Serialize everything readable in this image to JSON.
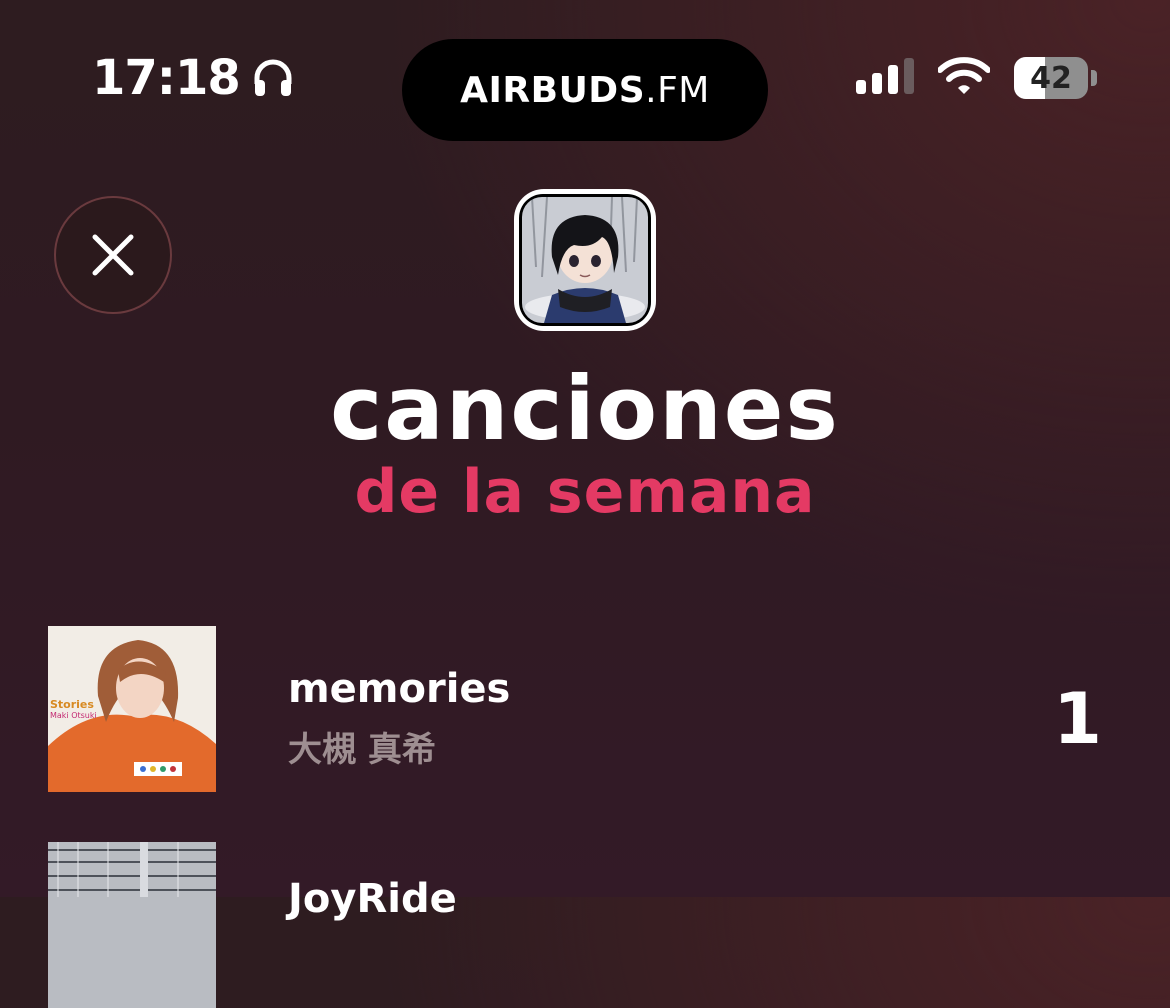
{
  "status_bar": {
    "time": "17:18",
    "battery": "42"
  },
  "brand": {
    "bold": "AIRBUDS",
    "thin": ".FM"
  },
  "header": {
    "title": "canciones",
    "subtitle": "de la semana",
    "accent_color": "#e43a64"
  },
  "tracks": [
    {
      "title": "memories",
      "artist": "大槻 真希",
      "rank": "1",
      "cover_text": "Stories",
      "cover_subtext": "Maki Otsuki"
    },
    {
      "title": "JoyRide",
      "artist": "",
      "rank": ""
    }
  ],
  "icons": {
    "close": "close-icon",
    "headphones": "headphones-icon",
    "signal": "cellular-signal-icon",
    "wifi": "wifi-icon",
    "battery": "battery-icon"
  }
}
